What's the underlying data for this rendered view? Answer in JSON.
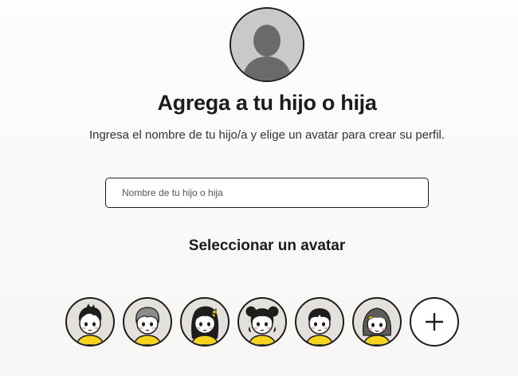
{
  "profile": {
    "photo_icon": "default-user-silhouette-icon"
  },
  "header": {
    "title": "Agrega a tu hijo o hija",
    "subtitle": "Ingresa el nombre de tu hijo/a y elige un avatar para crear su perfil."
  },
  "form": {
    "name_value": "",
    "name_placeholder": "Nombre de tu hijo o hija"
  },
  "avatars": {
    "section_title": "Seleccionar un avatar",
    "options": [
      {
        "icon": "boy-spiky-hair-avatar-icon"
      },
      {
        "icon": "boy-gray-hair-avatar-icon"
      },
      {
        "icon": "girl-long-hair-bow-avatar-icon"
      },
      {
        "icon": "girl-pigtail-buns-avatar-icon"
      },
      {
        "icon": "boy-short-hair-avatar-icon"
      },
      {
        "icon": "girl-bob-hair-clip-avatar-icon"
      }
    ],
    "add_icon": "plus-icon"
  },
  "colors": {
    "outline": "#1d1d1d",
    "shirt": "#f5d31e",
    "avatar_bg": "#e4e1dd",
    "placeholder_gray": "#c7c7c7"
  }
}
